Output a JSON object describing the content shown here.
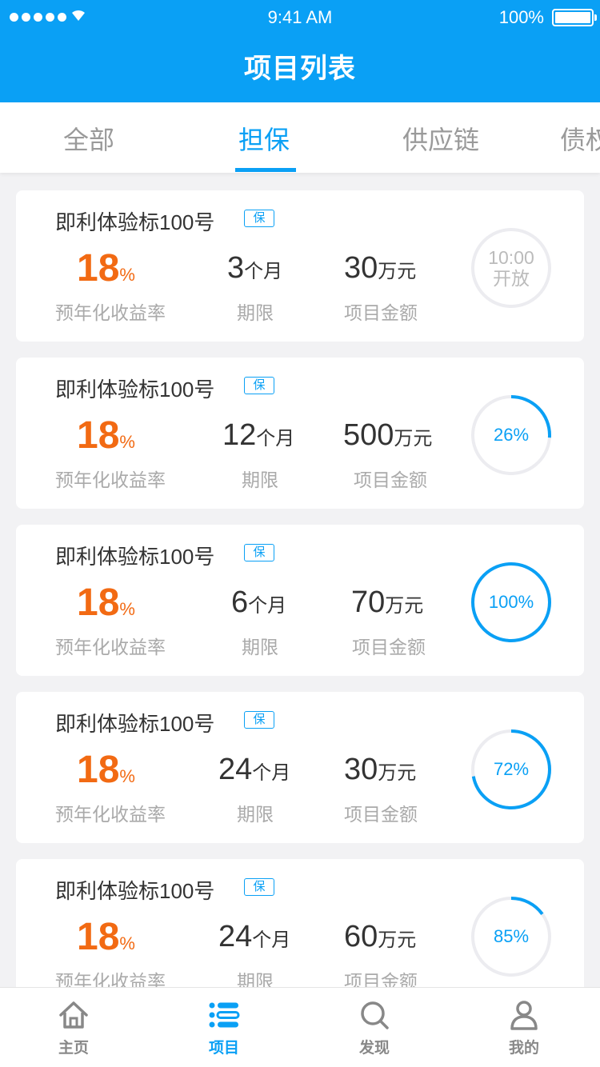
{
  "status_bar": {
    "time": "9:41 AM",
    "battery": "100%"
  },
  "header": {
    "title": "项目列表"
  },
  "tabs": [
    {
      "label": "全部",
      "active": false
    },
    {
      "label": "担保",
      "active": true
    },
    {
      "label": "供应链",
      "active": false
    },
    {
      "label": "债权",
      "active": false
    }
  ],
  "colors": {
    "primary": "#0aa0f5",
    "rate": "#f26a13",
    "ring_track": "#ececf0"
  },
  "labels": {
    "rate": "预年化收益率",
    "term": "期限",
    "amount": "项目金额"
  },
  "projects": [
    {
      "name": "即利体验标100号",
      "tag": "保",
      "rate": "18",
      "rate_unit": "%",
      "term": "3",
      "term_unit": "个月",
      "amount": "30",
      "amount_unit": "万元",
      "progress": 0,
      "status_time": "10:00",
      "status_text": "开放"
    },
    {
      "name": "即利体验标100号",
      "tag": "保",
      "rate": "18",
      "rate_unit": "%",
      "term": "12",
      "term_unit": "个月",
      "amount": "500",
      "amount_unit": "万元",
      "progress": 26,
      "progress_label": "26%"
    },
    {
      "name": "即利体验标100号",
      "tag": "保",
      "rate": "18",
      "rate_unit": "%",
      "term": "6",
      "term_unit": "个月",
      "amount": "70",
      "amount_unit": "万元",
      "progress": 100,
      "progress_label": "100%"
    },
    {
      "name": "即利体验标100号",
      "tag": "保",
      "rate": "18",
      "rate_unit": "%",
      "term": "24",
      "term_unit": "个月",
      "amount": "30",
      "amount_unit": "万元",
      "progress": 72,
      "progress_label": "72%"
    },
    {
      "name": "即利体验标100号",
      "tag": "保",
      "rate": "18",
      "rate_unit": "%",
      "term": "24",
      "term_unit": "个月",
      "amount": "60",
      "amount_unit": "万元",
      "progress": 15,
      "progress_label": "85%"
    }
  ],
  "nav": [
    {
      "label": "主页",
      "icon": "home-icon",
      "active": false
    },
    {
      "label": "项目",
      "icon": "list-icon",
      "active": true
    },
    {
      "label": "发现",
      "icon": "search-icon",
      "active": false
    },
    {
      "label": "我的",
      "icon": "user-icon",
      "active": false
    }
  ]
}
